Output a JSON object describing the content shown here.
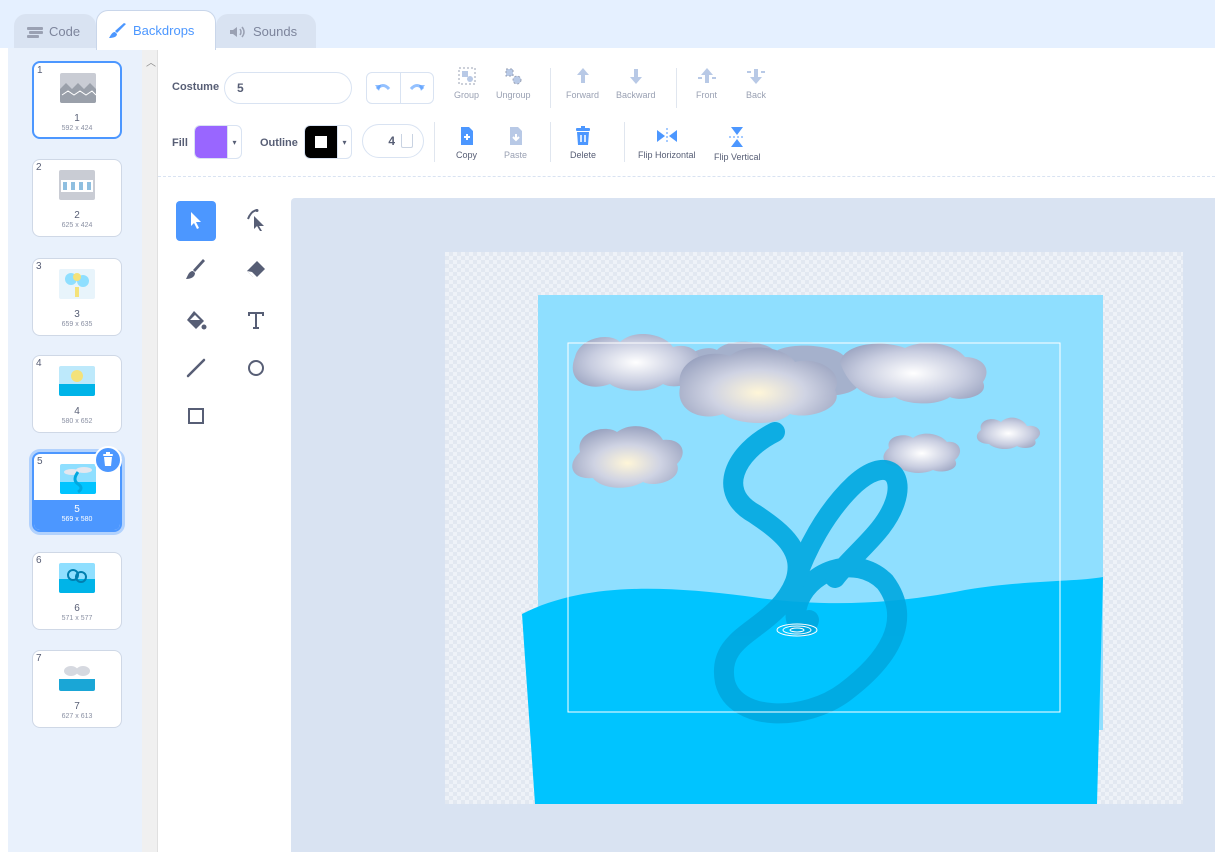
{
  "tabs": [
    {
      "label": "Code",
      "icon": "code-icon"
    },
    {
      "label": "Backdrops",
      "icon": "paintbrush-icon",
      "active": true
    },
    {
      "label": "Sounds",
      "icon": "speaker-icon"
    }
  ],
  "costumes": [
    {
      "number": "1",
      "name": "1",
      "size": "592 x 424"
    },
    {
      "number": "2",
      "name": "2",
      "size": "625 x 424"
    },
    {
      "number": "3",
      "name": "3",
      "size": "659 x 635"
    },
    {
      "number": "4",
      "name": "4",
      "size": "580 x 652"
    },
    {
      "number": "5",
      "name": "5",
      "size": "569 x 580",
      "selected": true
    },
    {
      "number": "6",
      "name": "6",
      "size": "571 x 577"
    },
    {
      "number": "7",
      "name": "7",
      "size": "627 x 613"
    }
  ],
  "toolbar": {
    "costume_label": "Costume",
    "costume_value": "5",
    "fill_label": "Fill",
    "outline_label": "Outline",
    "outline_width": "4",
    "fill_color": "#9966ff",
    "outline_color": "#000000",
    "group": "Group",
    "ungroup": "Ungroup",
    "forward": "Forward",
    "backward": "Backward",
    "front": "Front",
    "back": "Back",
    "copy": "Copy",
    "paste": "Paste",
    "delete": "Delete",
    "flip_horizontal": "Flip Horizontal",
    "flip_vertical": "Flip Vertical"
  },
  "tools": [
    "select-tool",
    "reshape-tool",
    "brush-tool",
    "eraser-tool",
    "fill-tool",
    "text-tool",
    "line-tool",
    "circle-tool",
    "rectangle-tool"
  ],
  "colors": {
    "accent": "#4c97ff",
    "sky": "#8fdfff",
    "water": "#00c4ff",
    "vine": "#00a8e0"
  }
}
